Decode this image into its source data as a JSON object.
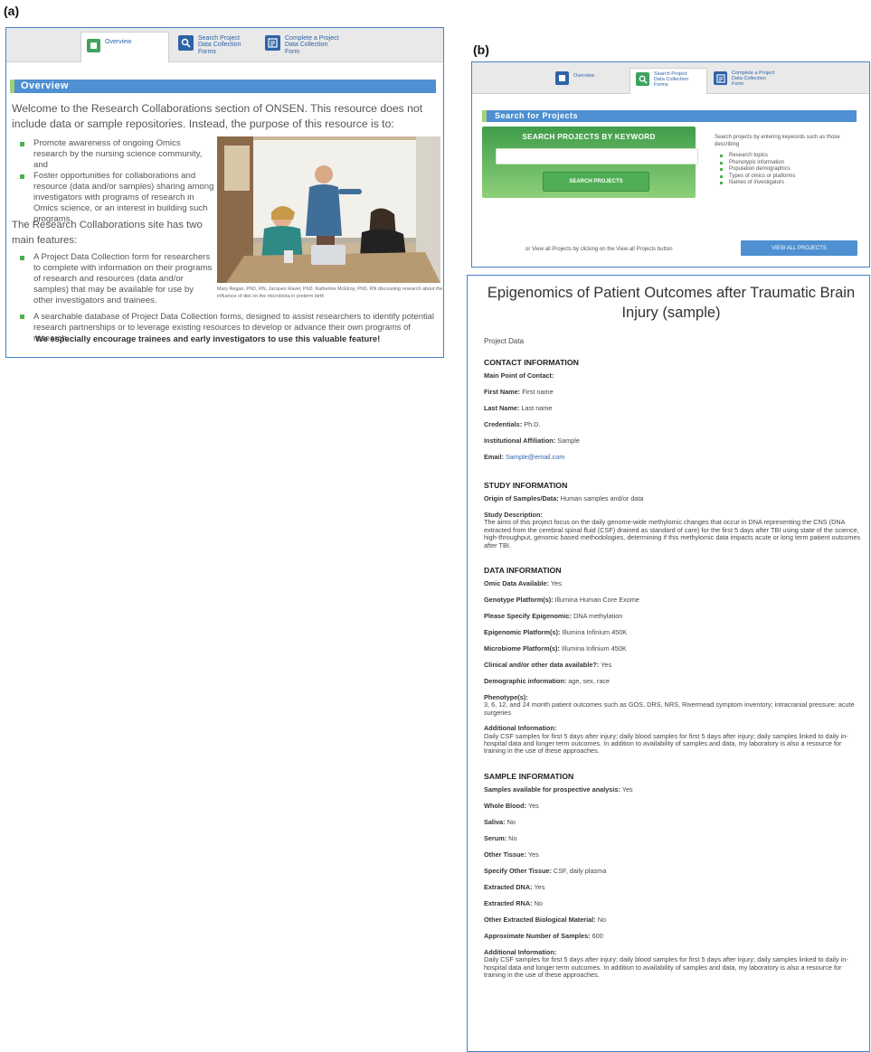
{
  "labels": {
    "a": "(a)",
    "b": "(b)"
  },
  "tabs": {
    "overview": "Overview",
    "search": [
      "Search Project",
      "Data Collection",
      "Forms"
    ],
    "complete": [
      "Complete a Project",
      "Data Collection",
      "Form"
    ]
  },
  "panel_a": {
    "section_title": "Overview",
    "intro": "Welcome to the Research Collaborations section of ONSEN. This resource does not include data or sample repositories. Instead, the purpose of this resource is to:",
    "bullets1": [
      "Promote awareness of ongoing Omics research by the nursing science community, and",
      "Foster opportunities for collaborations and resource (data and/or samples) sharing among investigators with programs of research in Omics science, or an interest in building such programs."
    ],
    "features_intro": "The Research Collaborations site has two main features:",
    "bullets2": [
      "A Project Data Collection form for researchers to complete with information on their programs of research and resources (data and/or samples) that may be available for use by other investigators and trainees.",
      "A searchable database of Project Data Collection forms, designed to assist researchers to identify potential research partnerships or to leverage existing resources to develop or advance their own programs of research."
    ],
    "encourage": "We especially encourage trainees and early investigators to use this valuable feature!",
    "photo_caption": "Mary Regan, PhD, RN, Jacques Ravel, PhD, Katherine McElroy, PhD, RN discussing research about the influence of diet on the microbiota in preterm birth"
  },
  "panel_b": {
    "section_title": "Search for Projects",
    "keyword_title": "SEARCH PROJECTS BY KEYWORD",
    "search_button": "SEARCH PROJECTS",
    "help_text": "Search projects by entering keywords such as those describing",
    "help_items": [
      "Research topics",
      "Phenotypic information",
      "Population demographics",
      "Types of omics or platforms",
      "Names of investigators"
    ],
    "or_text": "or View all Projects by clicking on the View all Projects button",
    "view_all_button": "VIEW ALL PROJECTS"
  },
  "panel_c": {
    "title": "Epigenomics of Patient Outcomes after Traumatic Brain Injury (sample)",
    "project_data": "Project Data",
    "contact": {
      "head": "CONTACT INFORMATION",
      "main_point": "Main Point of Contact:",
      "first_name_k": "First Name:",
      "first_name_v": "First name",
      "last_name_k": "Last Name:",
      "last_name_v": "Last name",
      "credentials_k": "Credentials:",
      "credentials_v": "Ph.D.",
      "affiliation_k": "Institutional Affiliation:",
      "affiliation_v": "Sample",
      "email_k": "Email:",
      "email_v": "Sample@email.com"
    },
    "study": {
      "head": "STUDY INFORMATION",
      "origin_k": "Origin of Samples/Data:",
      "origin_v": "Human samples and/or data",
      "desc_k": "Study Description:",
      "desc_v": "The aims of this project focus on the daily genome-wide methylomic changes that occur in DNA representing the CNS (DNA extracted from the cerebral spinal fluid (CSF) drained as standard of care) for the first 5 days after TBI using state of the science, high-throughput, genomic based methodologies, determining if this methylomic data impacts acute or long term patient outcomes after TBI."
    },
    "data": {
      "head": "DATA INFORMATION",
      "omic_k": "Omic Data Available:",
      "omic_v": "Yes",
      "genotype_k": "Genotype Platform(s):",
      "genotype_v": "Illumina Human Core Exome",
      "epi_spec_k": "Please Specify Epigenomic:",
      "epi_spec_v": "DNA methylation",
      "epi_plat_k": "Epigenomic Platform(s):",
      "epi_plat_v": "Illumina Infinium 450K",
      "micro_k": "Microbiome Platform(s):",
      "micro_v": "Illumina Infinium 450K",
      "clinical_k": "Clinical and/or other data available?:",
      "clinical_v": "Yes",
      "demo_k": "Demographic information:",
      "demo_v": "age, sex, race",
      "pheno_k": "Phenotype(s):",
      "pheno_v": "3, 6, 12, and 24 month patient outcomes such as GOS, DRS, NRS, Rivermead symptom inventory; intracranial pressure; acute surgeries",
      "addl_k": "Additional Information:",
      "addl_v": "Daily CSF samples for first 5 days after injury; daily blood samples for first 5 days after injury; daily samples linked to daily in-hospital data and longer term outcomes. In addition to availability of samples and data, my laboratory is also a resource for training in the use of these approaches."
    },
    "sample": {
      "head": "SAMPLE INFORMATION",
      "prospective_k": "Samples available for prospective analysis:",
      "prospective_v": "Yes",
      "blood_k": "Whole Blood:",
      "blood_v": "Yes",
      "saliva_k": "Saliva:",
      "saliva_v": "No",
      "serum_k": "Serum:",
      "serum_v": "No",
      "tissue_k": "Other Tissue:",
      "tissue_v": "Yes",
      "spec_tissue_k": "Specify Other Tissue:",
      "spec_tissue_v": "CSF, daily plasma",
      "dna_k": "Extracted DNA:",
      "dna_v": "Yes",
      "rna_k": "Extracted RNA:",
      "rna_v": "No",
      "bio_k": "Other Extracted Biological Material:",
      "bio_v": "No",
      "approx_k": "Approximate Number of Samples:",
      "approx_v": "600",
      "addl_k": "Additional Information:",
      "addl_v": "Daily CSF samples for first 5 days after injury; daily blood samples for first 5 days after injury; daily samples linked to daily in-hospital data and longer term outcomes. In addition to availability of samples and data, my laboratory is also a resource for training in the use of these approaches."
    }
  }
}
